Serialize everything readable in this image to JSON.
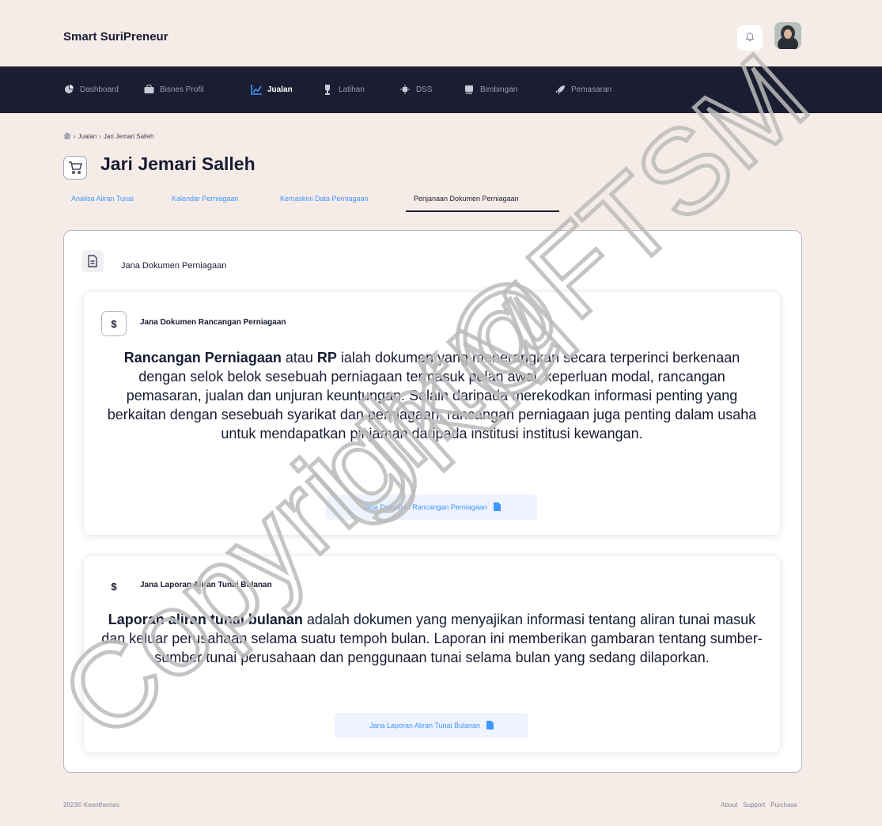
{
  "app": {
    "brand": "Smart SuriPreneur"
  },
  "nav": {
    "items": [
      {
        "label": "Dashboard",
        "icon": "pie-chart-icon"
      },
      {
        "label": "Bisnes Profil",
        "icon": "briefcase-icon"
      },
      {
        "label": "Jualan",
        "icon": "chart-icon",
        "active": true
      },
      {
        "label": "Latihan",
        "icon": "trophy-icon"
      },
      {
        "label": "DSS",
        "icon": "chip-icon"
      },
      {
        "label": "Bimbingan",
        "icon": "book-icon"
      },
      {
        "label": "Pemasaran",
        "icon": "rocket-icon"
      }
    ]
  },
  "breadcrumb": {
    "items": [
      "Jualan",
      "Jari Jemari Salleh"
    ]
  },
  "page": {
    "title": "Jari Jemari Salleh"
  },
  "tabs": [
    {
      "label": "Analisa Aliran Tunai"
    },
    {
      "label": "Kalendar Perniagaan"
    },
    {
      "label": "Kemaskini Data Perniagaan"
    },
    {
      "label": "Penjanaan Dokumen Perniagaan",
      "active": true
    }
  ],
  "main": {
    "heading": "Jana Dokumen Perniagaan",
    "cards": [
      {
        "heading": "Jana Dokumen Rancangan Perniagaan",
        "bold_lead": "Rancangan Perniagaan",
        "mid_text": " atau ",
        "bold_mid": "RP",
        "rest": " ialah dokumen yang menerangkan secara terperinci berkenaan dengan selok belok sesebuah perniagaan termasuk pelan awal, keperluan modal, rancangan pemasaran, jualan dan unjuran keuntungan. Selain daripada merekodkan informasi penting yang berkaitan dengan sesebuah syarikat dan perniagaan, rancangan perniagaan juga penting dalam usaha untuk mendapatkan pinjaman daripada institusi institusi kewangan.",
        "button": "Jana Dokumen Rancangan Perniagaan"
      },
      {
        "heading": "Jana Laporan Aliran Tunai Bulanan",
        "bold_lead": "Laporan aliran tunai bulanan",
        "rest": " adalah dokumen yang menyajikan informasi tentang aliran tunai masuk dan keluar perusahaan selama suatu tempoh bulan. Laporan ini memberikan gambaran tentang sumber-sumber tunai perusahaan dan penggunaan tunai selama bulan yang sedang dilaporkan.",
        "button": "Jana Laporan Aliran Tunai Bulanan"
      }
    ]
  },
  "footer": {
    "copyright": "2023© Keenthemes",
    "links": [
      "About",
      "Support",
      "Purchase"
    ]
  },
  "watermark": {
    "text1": "Copyright@FTSM",
    "text2": "UKM"
  },
  "colors": {
    "nav_bg": "#1b1d30",
    "accent": "#3e97ff",
    "page_bg": "#f6ece7"
  }
}
